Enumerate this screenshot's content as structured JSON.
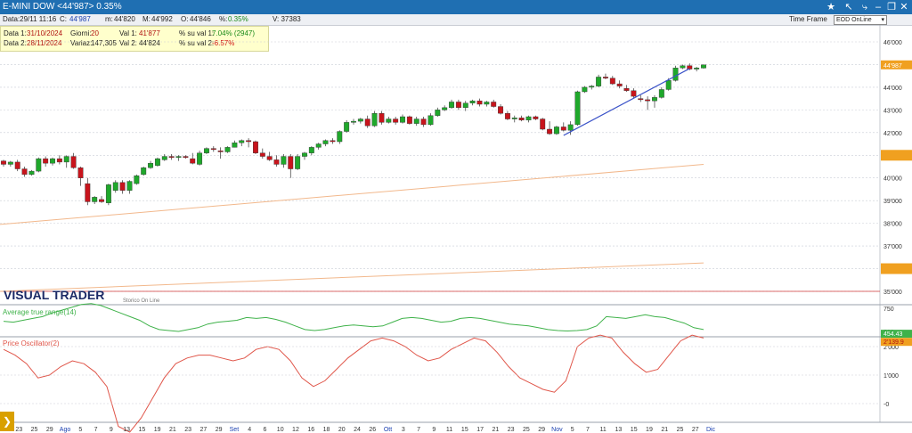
{
  "window": {
    "title": "E-MINI DOW <44'987> 0.35%"
  },
  "infobar": {
    "data": "Data:29/11 11:16",
    "close_key": "C:",
    "close_val": "44'987",
    "min_key": "m:",
    "min_val": "44'820",
    "max_key": "M:",
    "max_val": "44'992",
    "open_key": "O:",
    "open_val": "44'846",
    "pct_key": "%:",
    "pct_val": "0.35%",
    "vol": "V: 37383",
    "timeframe_label": "Time Frame",
    "timeframe_value": "EOD OnLine"
  },
  "databox": {
    "d1_label": "Data 1:",
    "d1_val": "31/10/2024",
    "d2_label": "Data 2:",
    "d2_val": "28/11/2024",
    "giorni_label": "Giorni:",
    "giorni_val": "20",
    "variaz_label": "Variaz:",
    "variaz_val": "147,305",
    "val1_label": "Val 1:",
    "val1_val": "41'877",
    "val2_label": "Val 2:",
    "val2_val": "44'824",
    "pct1_label": "% su val 1:",
    "pct1_val": "7.04% (2947)",
    "pct2_label": "% su val 2:",
    "pct2_val": "-6.57%"
  },
  "brand": {
    "logo": "VISUAL TRADER",
    "sub": "Storico On Line"
  },
  "colors": {
    "up": "#1fa82b",
    "down": "#c8141c",
    "trend": "#3a52c8",
    "atr": "#3fb24a",
    "osc": "#e0564a",
    "channel": "#f2b88c",
    "hline": "#d23a3a",
    "price_tag": "#f0a020"
  },
  "chart_data": [
    {
      "type": "candlestick",
      "price_tag": "44'987",
      "y_ticks": [
        "35'000",
        "36'000",
        "37'000",
        "38'000",
        "39'000",
        "40'000",
        "41'000",
        "42'000",
        "43'000",
        "44'000",
        "45'000",
        "46'000"
      ],
      "ylim": [
        35000,
        46200
      ],
      "x_ticks": [
        "19",
        "23",
        "25",
        "29",
        "Ago",
        "5",
        "7",
        "9",
        "13",
        "15",
        "19",
        "21",
        "23",
        "27",
        "29",
        "Set",
        "4",
        "6",
        "10",
        "12",
        "16",
        "18",
        "20",
        "24",
        "26",
        "Ott",
        "3",
        "7",
        "9",
        "11",
        "15",
        "17",
        "21",
        "23",
        "25",
        "29",
        "Nov",
        "5",
        "7",
        "11",
        "13",
        "15",
        "19",
        "21",
        "25",
        "27",
        "Dic"
      ],
      "ohlc": [
        [
          40750,
          40800,
          40500,
          40600
        ],
        [
          40600,
          40750,
          40500,
          40700
        ],
        [
          40700,
          40800,
          40300,
          40400
        ],
        [
          40400,
          40500,
          40050,
          40150
        ],
        [
          40150,
          40350,
          40100,
          40300
        ],
        [
          40300,
          40900,
          40250,
          40850
        ],
        [
          40850,
          40950,
          40500,
          40650
        ],
        [
          40650,
          40900,
          40550,
          40850
        ],
        [
          40850,
          41000,
          40600,
          40700
        ],
        [
          40700,
          41000,
          40450,
          40950
        ],
        [
          40950,
          41100,
          40400,
          40450
        ],
        [
          40450,
          40500,
          39650,
          40000
        ],
        [
          39750,
          40000,
          38800,
          38950
        ],
        [
          38950,
          39200,
          38850,
          39150
        ],
        [
          39050,
          39200,
          38900,
          38950
        ],
        [
          38900,
          39750,
          38800,
          39700
        ],
        [
          39450,
          39900,
          39350,
          39800
        ],
        [
          39800,
          39900,
          39300,
          39450
        ],
        [
          39450,
          39900,
          39300,
          39850
        ],
        [
          39750,
          40150,
          39700,
          40100
        ],
        [
          40150,
          40500,
          40100,
          40450
        ],
        [
          40450,
          40750,
          40400,
          40650
        ],
        [
          40550,
          40900,
          40500,
          40850
        ],
        [
          40800,
          41050,
          40750,
          40950
        ],
        [
          40950,
          41050,
          40800,
          40900
        ],
        [
          40900,
          41000,
          40750,
          40950
        ],
        [
          40950,
          41000,
          40850,
          40900
        ],
        [
          40850,
          41100,
          40600,
          40650
        ],
        [
          40600,
          41200,
          40550,
          41100
        ],
        [
          41100,
          41350,
          41050,
          41300
        ],
        [
          41300,
          41400,
          41150,
          41250
        ],
        [
          41200,
          41350,
          40850,
          41150
        ],
        [
          41150,
          41400,
          41100,
          41350
        ],
        [
          41350,
          41650,
          41350,
          41550
        ],
        [
          41550,
          41700,
          41400,
          41650
        ],
        [
          41650,
          41750,
          41350,
          41600
        ],
        [
          41600,
          41650,
          41050,
          41100
        ],
        [
          41100,
          41300,
          40850,
          40950
        ],
        [
          40950,
          41150,
          40750,
          40800
        ],
        [
          40800,
          41000,
          40500,
          40600
        ],
        [
          40600,
          41050,
          40450,
          40950
        ],
        [
          40950,
          41050,
          40000,
          40400
        ],
        [
          40400,
          41050,
          40350,
          40950
        ],
        [
          40950,
          41150,
          40800,
          41100
        ],
        [
          41100,
          41400,
          41000,
          41350
        ],
        [
          41350,
          41550,
          41250,
          41500
        ],
        [
          41500,
          41700,
          41400,
          41650
        ],
        [
          41650,
          41750,
          41500,
          41600
        ],
        [
          41600,
          42100,
          41500,
          42050
        ],
        [
          42050,
          42550,
          42000,
          42450
        ],
        [
          42450,
          42600,
          42350,
          42500
        ],
        [
          42500,
          42650,
          42400,
          42600
        ],
        [
          42600,
          42750,
          42200,
          42300
        ],
        [
          42300,
          42950,
          42250,
          42850
        ],
        [
          42850,
          42950,
          42350,
          42450
        ],
        [
          42450,
          42700,
          42400,
          42600
        ],
        [
          42600,
          42700,
          42350,
          42450
        ],
        [
          42450,
          42800,
          42400,
          42700
        ],
        [
          42700,
          42750,
          42350,
          42400
        ],
        [
          42400,
          42700,
          42300,
          42600
        ],
        [
          42600,
          42700,
          42250,
          42350
        ],
        [
          42350,
          42850,
          42300,
          42750
        ],
        [
          42750,
          43100,
          42700,
          43000
        ],
        [
          43000,
          43200,
          42950,
          43100
        ],
        [
          43100,
          43450,
          43050,
          43350
        ],
        [
          43350,
          43450,
          43000,
          43100
        ],
        [
          43100,
          43400,
          42950,
          43300
        ],
        [
          43300,
          43450,
          43200,
          43400
        ],
        [
          43400,
          43500,
          43150,
          43250
        ],
        [
          43250,
          43400,
          43150,
          43350
        ],
        [
          43350,
          43450,
          43100,
          43150
        ],
        [
          43150,
          43250,
          42800,
          42850
        ],
        [
          42850,
          42950,
          42550,
          42600
        ],
        [
          42600,
          42750,
          42450,
          42650
        ],
        [
          42650,
          42750,
          42500,
          42550
        ],
        [
          42550,
          42750,
          42450,
          42700
        ],
        [
          42700,
          42750,
          42550,
          42600
        ],
        [
          42600,
          42650,
          42100,
          42150
        ],
        [
          42150,
          42500,
          41900,
          41950
        ],
        [
          41950,
          42300,
          41900,
          42250
        ],
        [
          42250,
          42450,
          42050,
          42100
        ],
        [
          42100,
          42500,
          41900,
          42350
        ],
        [
          42350,
          43850,
          42300,
          43800
        ],
        [
          43800,
          44050,
          43750,
          44000
        ],
        [
          44000,
          44100,
          43900,
          44050
        ],
        [
          44050,
          44550,
          44000,
          44450
        ],
        [
          44450,
          44600,
          44350,
          44400
        ],
        [
          44400,
          44500,
          44100,
          44150
        ],
        [
          44150,
          44300,
          43950,
          44050
        ],
        [
          43950,
          44100,
          43800,
          43850
        ],
        [
          43850,
          43950,
          43500,
          43600
        ],
        [
          43500,
          43650,
          43350,
          43450
        ],
        [
          43450,
          43600,
          43000,
          43400
        ],
        [
          43400,
          43650,
          43100,
          43550
        ],
        [
          43550,
          44000,
          43500,
          43900
        ],
        [
          43900,
          44400,
          43850,
          44300
        ],
        [
          44300,
          44950,
          44250,
          44850
        ],
        [
          44850,
          45000,
          44800,
          44950
        ],
        [
          44950,
          45050,
          44750,
          44800
        ],
        [
          44800,
          44900,
          44700,
          44850
        ],
        [
          44846,
          44992,
          44820,
          44987
        ]
      ],
      "trendline": [
        [
          41877,
          "31/10/2024"
        ],
        [
          44824,
          "28/11/2024"
        ]
      ]
    },
    {
      "type": "line",
      "name": "Average true range(14)",
      "y_ticks": [
        "500",
        "750"
      ],
      "last_value_tag": "454.43"
    },
    {
      "type": "line",
      "name": "Price Oscillator(2)",
      "y_ticks": [
        "-0",
        "1'000",
        "2'000"
      ],
      "last_value_tag": "2'139.9"
    }
  ]
}
